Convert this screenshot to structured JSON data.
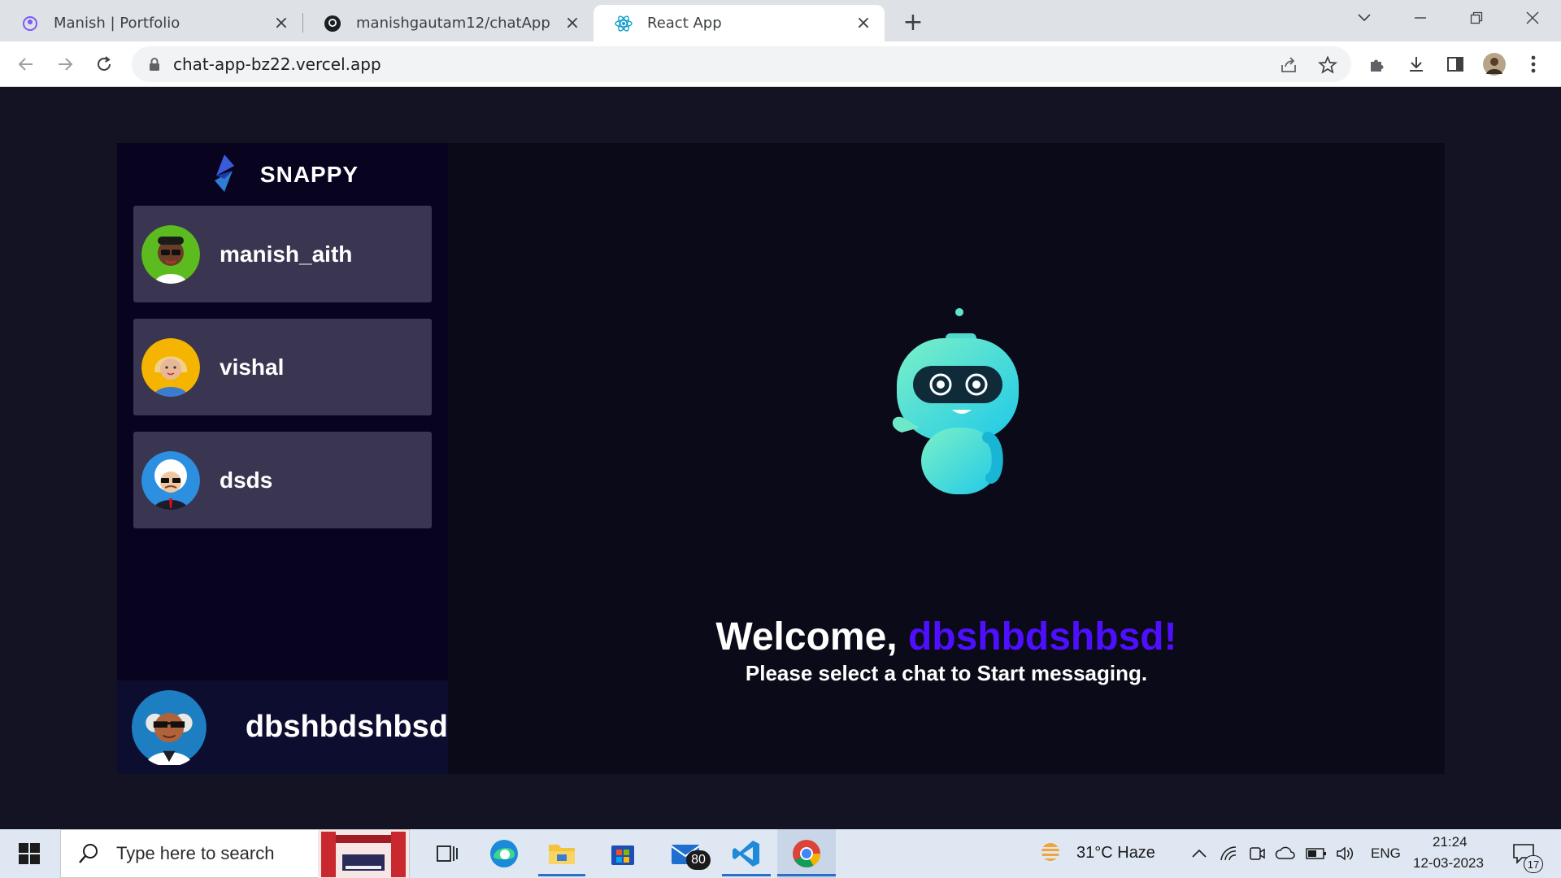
{
  "browser": {
    "tabs": [
      {
        "title": "Manish | Portfolio",
        "favicon": "portfolio-icon",
        "active": false
      },
      {
        "title": "manishgautam12/chatApp",
        "favicon": "github-icon",
        "active": false
      },
      {
        "title": "React App",
        "favicon": "react-icon",
        "active": true
      }
    ],
    "url": "chat-app-bz22.vercel.app"
  },
  "app": {
    "brand": "SNAPPY",
    "contacts": [
      {
        "name": "manish_aith",
        "avatar": "green-avatar"
      },
      {
        "name": "vishal",
        "avatar": "yellow-avatar"
      },
      {
        "name": "dsds",
        "avatar": "blue-avatar"
      }
    ],
    "current_user": {
      "name": "dbshbdshbsd"
    },
    "welcome": {
      "greeting": "Welcome, ",
      "username": "dbshbdshbsd!",
      "subtitle": "Please select a chat to Start messaging."
    },
    "colors": {
      "accent": "#4e0eff",
      "sidebar": "#080420",
      "card": "#3a3550",
      "background": "#131324"
    }
  },
  "taskbar": {
    "search_placeholder": "Type here to search",
    "mail_badge": "80",
    "weather": "31°C  Haze",
    "language": "ENG",
    "time": "21:24",
    "date": "12-03-2023",
    "notifications": "17"
  }
}
